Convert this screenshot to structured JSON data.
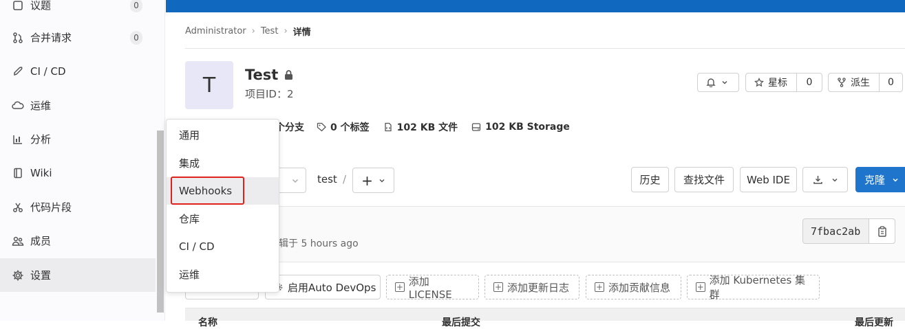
{
  "sidebar": {
    "items": [
      {
        "label": "议题",
        "icon": "issues-icon",
        "badge": "0"
      },
      {
        "label": "合并请求",
        "icon": "merge-request-icon",
        "badge": "0"
      },
      {
        "label": "CI / CD",
        "icon": "rocket-icon"
      },
      {
        "label": "运维",
        "icon": "cloud-gear-icon"
      },
      {
        "label": "分析",
        "icon": "chart-icon"
      },
      {
        "label": "Wiki",
        "icon": "book-icon"
      },
      {
        "label": "代码片段",
        "icon": "scissors-icon"
      },
      {
        "label": "成员",
        "icon": "users-icon"
      },
      {
        "label": "设置",
        "icon": "gear-icon"
      }
    ]
  },
  "breadcrumb": {
    "items": [
      "Administrator",
      "Test",
      "详情"
    ]
  },
  "project": {
    "avatar_letter": "T",
    "name": "Test",
    "id_label": "项目ID：2"
  },
  "actions": {
    "star_label": "星标",
    "star_count": "0",
    "fork_label": "派生",
    "fork_count": "0"
  },
  "stats": {
    "branches": "个分支",
    "tags": "0 个标签",
    "files": "102 KB 文件",
    "storage": "102 KB Storage"
  },
  "toolbar": {
    "path": "test",
    "path_sep": "/",
    "history": "历史",
    "find_file": "查找文件",
    "web_ide": "Web IDE",
    "clone": "克隆"
  },
  "commit": {
    "title_fragment": ":",
    "edited": "辑于 5 hours ago",
    "sha": "7fbac2ab"
  },
  "quick_actions": {
    "auto_devops": "启用Auto DevOps",
    "license": "添加LICENSE",
    "changelog": "添加更新日志",
    "contributing": "添加贡献信息",
    "kubernetes": "添加 Kubernetes 集群"
  },
  "table": {
    "col_name": "名称",
    "col_commit": "最后提交",
    "col_updated": "最后更新"
  },
  "settings_menu": {
    "items": [
      "通用",
      "集成",
      "Webhooks",
      "仓库",
      "CI / CD",
      "运维"
    ]
  }
}
